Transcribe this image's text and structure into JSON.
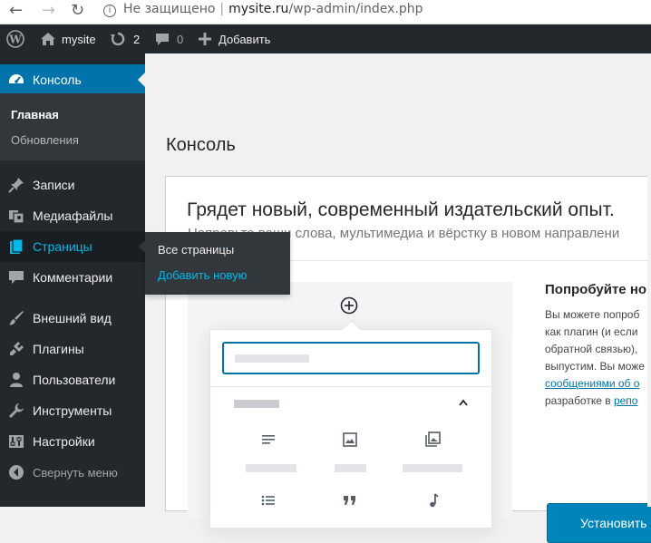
{
  "browser": {
    "not_secure": "Не защищено",
    "separator": "|",
    "host": "mysite.ru",
    "path": "/wp-admin/index.php"
  },
  "adminbar": {
    "site_name": "mysite",
    "updates_count": "2",
    "comments_count": "0",
    "add_new": "Добавить"
  },
  "sidebar": {
    "console": "Консоль",
    "submenu": [
      "Главная",
      "Обновления"
    ],
    "posts": "Записи",
    "media": "Медиафайлы",
    "pages": "Страницы",
    "comments": "Комментарии",
    "appearance": "Внешний вид",
    "plugins": "Плагины",
    "users": "Пользователи",
    "tools": "Инструменты",
    "settings": "Настройки",
    "collapse": "Свернуть меню"
  },
  "flyout": {
    "all_pages": "Все страницы",
    "add_new": "Добавить новую"
  },
  "main": {
    "title": "Консоль",
    "welcome_heading": "Грядет новый, современный издательский опыт.",
    "welcome_sub": "Направьте ваши слова, мультимедиа и вёрстку в новом направлени",
    "try_heading": "Попробуйте но",
    "try_lines": [
      "Вы можете попроб",
      "как плагин (и если",
      "обратной связью),",
      "выпустим. Вы може"
    ],
    "try_link1": "сообщениями об о",
    "try_line_tail": "разработке в ",
    "try_link2": "репо",
    "install_button": "Установить"
  },
  "colors": {
    "adminbar_bg": "#23282d",
    "accent": "#0073aa",
    "link": "#00b9eb"
  }
}
